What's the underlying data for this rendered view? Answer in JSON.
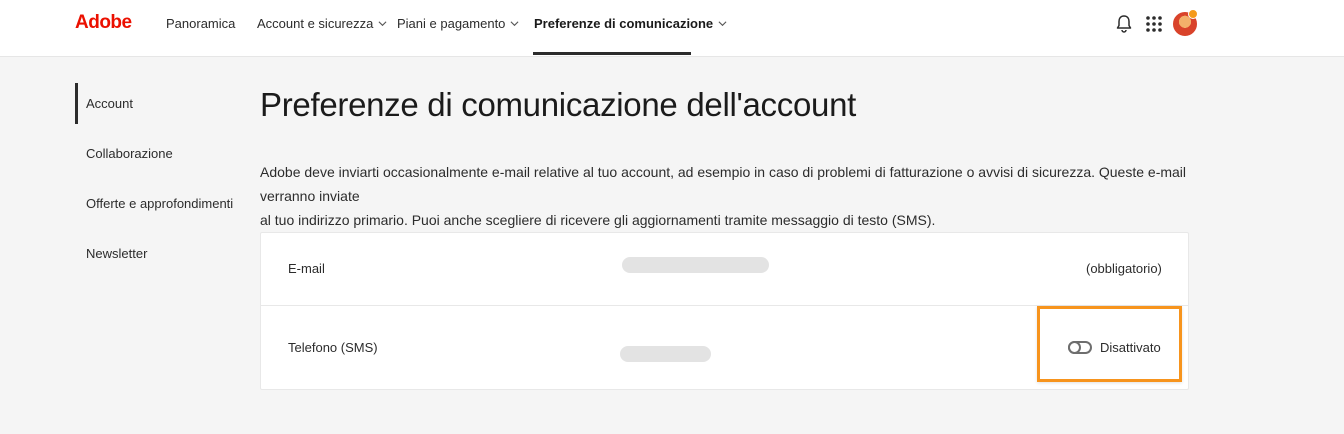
{
  "app": {
    "logo": "Adobe"
  },
  "nav": {
    "items": [
      {
        "label": "Panoramica"
      },
      {
        "label": "Account e sicurezza"
      },
      {
        "label": "Piani e pagamento"
      },
      {
        "label": "Preferenze di comunicazione"
      }
    ],
    "active": "Preferenze di comunicazione"
  },
  "header_icons": [
    "bell-icon",
    "app-grid-icon",
    "avatar"
  ],
  "sidebar": {
    "items": [
      {
        "label": "Account",
        "selected": true
      },
      {
        "label": "Collaborazione"
      },
      {
        "label": "Offerte e approfondimenti"
      },
      {
        "label": "Newsletter"
      }
    ]
  },
  "main": {
    "title": "Preferenze di comunicazione dell'account",
    "description_line1": "Adobe deve inviarti occasionalmente e-mail relative al tuo account, ad esempio in caso di problemi di fatturazione o avvisi di sicurezza. Queste e-mail verranno inviate",
    "description_line2": "al tuo indirizzo primario. Puoi anche scegliere di ricevere gli aggiornamenti tramite messaggio di testo (SMS).",
    "rows": [
      {
        "label": "E-mail",
        "status": "(obbligatorio)"
      },
      {
        "label": "Telefono (SMS)",
        "toggle_label": "Disattivato",
        "toggle_on": false
      }
    ]
  },
  "colors": {
    "brand": "#eb1000",
    "highlight": "#f7941d",
    "background": "#f5f5f5"
  }
}
